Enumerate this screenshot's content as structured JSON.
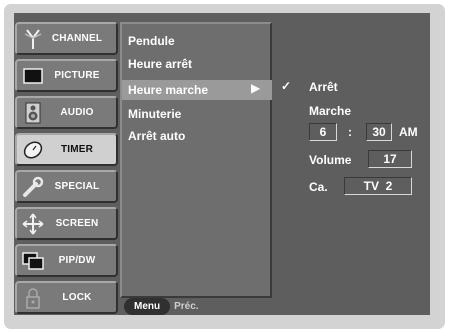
{
  "sidebar": {
    "items": [
      {
        "label": "CHANNEL",
        "icon": "antenna-icon"
      },
      {
        "label": "PICTURE",
        "icon": "tv-screen-icon"
      },
      {
        "label": "AUDIO",
        "icon": "speaker-icon"
      },
      {
        "label": "TIMER",
        "icon": "clock-icon",
        "active": true
      },
      {
        "label": "SPECIAL",
        "icon": "wrench-icon"
      },
      {
        "label": "SCREEN",
        "icon": "move-arrows-icon"
      },
      {
        "label": "PIP/DW",
        "icon": "pip-icon"
      },
      {
        "label": "LOCK",
        "icon": "padlock-icon"
      }
    ]
  },
  "submenu": {
    "items": [
      "Pendule",
      "Heure arrêt",
      "Heure marche",
      "Minuterie",
      "Arrêt auto"
    ],
    "selected_index": 2,
    "arrow": "▶"
  },
  "footer": {
    "menu_label": "Menu",
    "prev_label": "Préc."
  },
  "panel": {
    "check": "✓",
    "off_label": "Arrêt",
    "on_label": "Marche",
    "hour": "6",
    "separator": ":",
    "minute": "30",
    "ampm": "AM",
    "volume_label": "Volume",
    "volume_value": "17",
    "channel_label": "Ca.",
    "channel_value": "TV  2"
  },
  "colors": {
    "background": "#5e5e5e",
    "frame": "#d3d3d3",
    "active_item": "#d0d0d0",
    "highlight": "#9a9a9a"
  }
}
